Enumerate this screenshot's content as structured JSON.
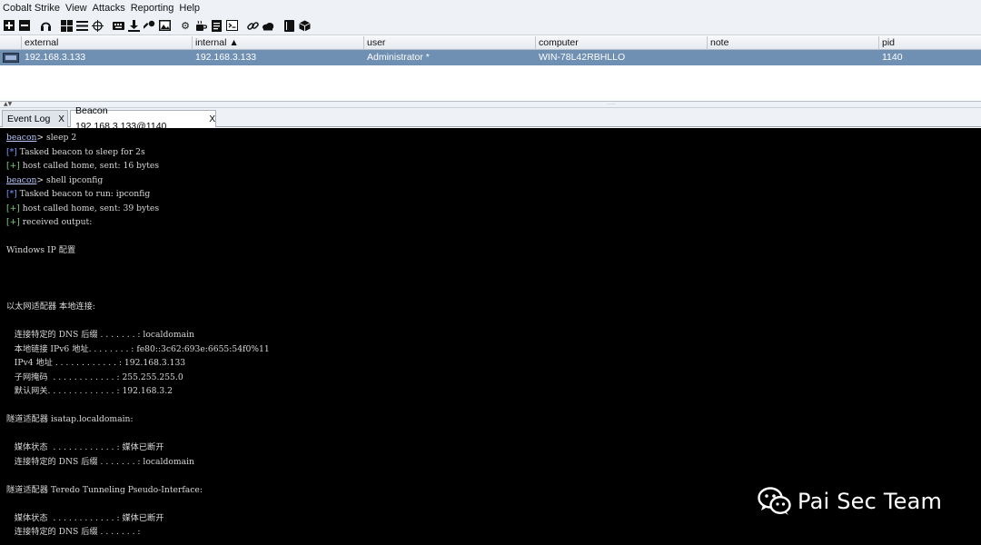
{
  "menu": [
    "Cobalt Strike",
    "View",
    "Attacks",
    "Reporting",
    "Help"
  ],
  "toolbar_icons": [
    "plus-icon",
    "minus-icon",
    "headphones-icon",
    "targets-icon",
    "list-icon",
    "crosshair-icon",
    "keyboard-icon",
    "download-icon",
    "key-icon",
    "image-icon",
    "gear-icon",
    "coffee-icon",
    "document-icon",
    "terminal-icon",
    "link-icon",
    "cloud-icon",
    "book-icon",
    "cube-icon"
  ],
  "table": {
    "columns": [
      "",
      "external",
      "internal ▲",
      "user",
      "computer",
      "note",
      "pid"
    ],
    "rows": [
      {
        "external": "192.168.3.133",
        "internal": "192.168.3.133",
        "user": "Administrator *",
        "computer": "WIN-78L42RBHLLO",
        "note": "",
        "pid": "1140"
      }
    ]
  },
  "tabs": [
    {
      "label": "Event Log",
      "close": "X",
      "active": false
    },
    {
      "label": "Beacon 192.168.3.133@1140",
      "close": "X",
      "active": true
    }
  ],
  "console": {
    "lines": [
      {
        "kind": "prompt",
        "prompt": "beacon",
        "text": "> sleep 2"
      },
      {
        "kind": "star",
        "prefix": "[*]",
        "text": " Tasked beacon to sleep for 2s"
      },
      {
        "kind": "plus",
        "prefix": "[+]",
        "text": " host called home, sent: 16 bytes"
      },
      {
        "kind": "prompt",
        "prompt": "beacon",
        "text": "> shell ipconfig"
      },
      {
        "kind": "star",
        "prefix": "[*]",
        "text": " Tasked beacon to run: ipconfig"
      },
      {
        "kind": "plus",
        "prefix": "[+]",
        "text": " host called home, sent: 39 bytes"
      },
      {
        "kind": "plus",
        "prefix": "[+]",
        "text": " received output:"
      },
      {
        "kind": "text",
        "text": ""
      },
      {
        "kind": "text",
        "text": "Windows IP 配置"
      },
      {
        "kind": "text",
        "text": ""
      },
      {
        "kind": "text",
        "text": ""
      },
      {
        "kind": "text",
        "text": ""
      },
      {
        "kind": "text",
        "text": "以太网适配器 本地连接:"
      },
      {
        "kind": "text",
        "text": ""
      },
      {
        "kind": "text",
        "text": "   连接特定的 DNS 后缀 . . . . . . . : localdomain"
      },
      {
        "kind": "text",
        "text": "   本地链接 IPv6 地址. . . . . . . . : fe80::3c62:693e:6655:54f0%11"
      },
      {
        "kind": "text",
        "text": "   IPv4 地址 . . . . . . . . . . . . : 192.168.3.133"
      },
      {
        "kind": "text",
        "text": "   子网掩码  . . . . . . . . . . . . : 255.255.255.0"
      },
      {
        "kind": "text",
        "text": "   默认网关. . . . . . . . . . . . . : 192.168.3.2"
      },
      {
        "kind": "text",
        "text": ""
      },
      {
        "kind": "text",
        "text": "隧道适配器 isatap.localdomain:"
      },
      {
        "kind": "text",
        "text": ""
      },
      {
        "kind": "text",
        "text": "   媒体状态  . . . . . . . . . . . . : 媒体已断开"
      },
      {
        "kind": "text",
        "text": "   连接特定的 DNS 后缀 . . . . . . . : localdomain"
      },
      {
        "kind": "text",
        "text": ""
      },
      {
        "kind": "text",
        "text": "隧道适配器 Teredo Tunneling Pseudo-Interface:"
      },
      {
        "kind": "text",
        "text": ""
      },
      {
        "kind": "text",
        "text": "   媒体状态  . . . . . . . . . . . . : 媒体已断开"
      },
      {
        "kind": "text",
        "text": "   连接特定的 DNS 后缀 . . . . . . . :"
      }
    ]
  },
  "watermark": {
    "text": "Pai Sec Team"
  },
  "colors": {
    "selection": "#6f8fb3",
    "console_bg": "#000000",
    "prompt": "#b7c8ff",
    "info": "#7a9bff",
    "success": "#7fd27f"
  }
}
